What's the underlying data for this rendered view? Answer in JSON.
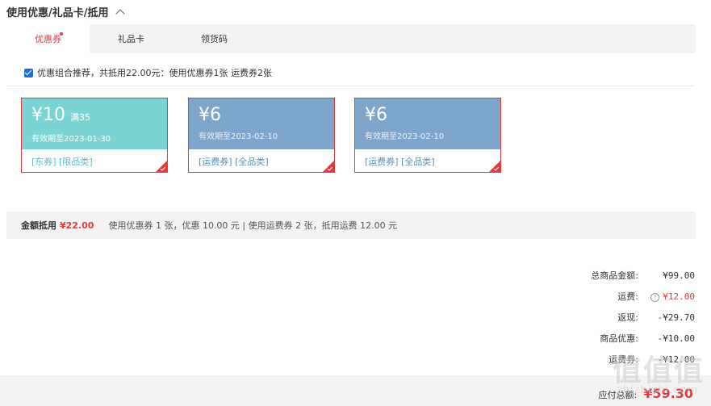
{
  "section": {
    "title": "使用优惠/礼品卡/抵用"
  },
  "tabs": [
    {
      "label": "优惠券"
    },
    {
      "label": "礼品卡"
    },
    {
      "label": "领货码"
    }
  ],
  "combo": {
    "text": "优惠组合推荐，共抵用22.00元：使用优惠券1张 运费券2张"
  },
  "coupons": [
    {
      "symbol": "¥",
      "amount": "10",
      "condition": "满35",
      "expiry": "有效期至2023-01-30",
      "tags": "[东券] [限品类]",
      "color": "#7bd3d4"
    },
    {
      "symbol": "¥",
      "amount": "6",
      "condition": "",
      "expiry": "有效期至2023-02-10",
      "tags": "[运费券] [全品类]",
      "color": "#7ea6cb"
    },
    {
      "symbol": "¥",
      "amount": "6",
      "condition": "",
      "expiry": "有效期至2023-02-10",
      "tags": "[运费券] [全品类]",
      "color": "#7ea6cb"
    }
  ],
  "summary": {
    "label": "金额抵用",
    "value": "¥22.00",
    "detail": "使用优惠券 1 张，优惠 10.00 元 | 使用运费券 2 张，抵用运费 12.00 元"
  },
  "totals": [
    {
      "label": "总商品金额:",
      "value": "¥99.00"
    },
    {
      "label": "运费:",
      "value": "¥12.00"
    },
    {
      "label": "返现:",
      "value": "-¥29.70"
    },
    {
      "label": "商品优惠:",
      "value": "-¥10.00"
    },
    {
      "label": "运费券:",
      "value": "-¥12.00"
    }
  ],
  "payable": {
    "label": "应付总额:",
    "value": "¥59.30"
  },
  "watermark": {
    "main": "值值值",
    "sub": "zhizhizhi.com"
  },
  "colors": {
    "accent": "#e4393c",
    "teal": "#7bd3d4",
    "blue": "#7ea6cb",
    "link": "#5a8fb8"
  }
}
